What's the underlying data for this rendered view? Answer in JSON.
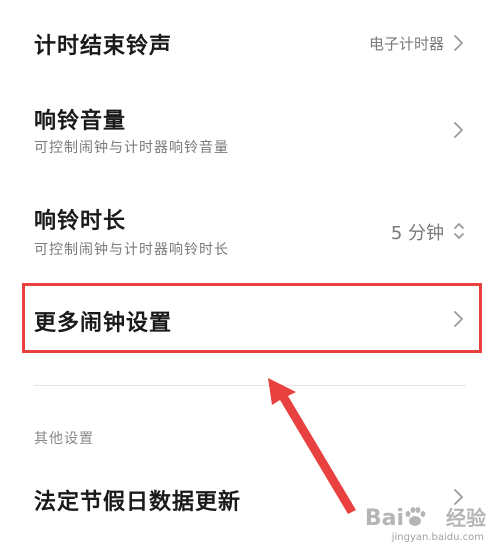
{
  "settings": {
    "items": [
      {
        "title": "计时结束铃声",
        "value": "电子计时器"
      },
      {
        "title": "响铃音量",
        "subtitle": "可控制闹钟与计时器响铃音量"
      },
      {
        "title": "响铃时长",
        "subtitle": "可控制闹钟与计时器响铃时长",
        "value": "5 分钟"
      },
      {
        "title": "更多闹钟设置"
      }
    ],
    "other_section_header": "其他设置",
    "other_items": [
      {
        "title": "法定节假日数据更新"
      }
    ]
  },
  "annotation": {
    "highlight_color": "#e8413f",
    "arrow_color": "#e8413f"
  },
  "watermark": {
    "brand": "Bai",
    "brand_suffix": "经验",
    "url": "jingyan.baidu.com"
  },
  "icons": {
    "chevron": "chevron-right-icon",
    "updown": "chevron-up-down-icon"
  }
}
